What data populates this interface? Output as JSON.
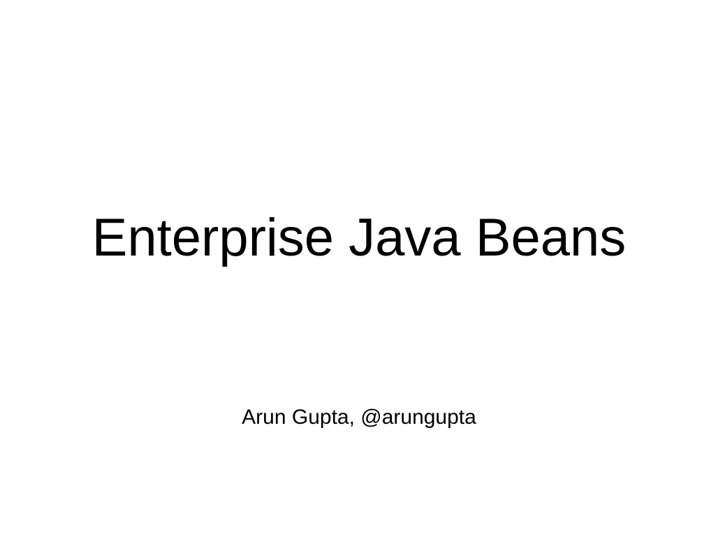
{
  "slide": {
    "title": "Enterprise Java Beans",
    "subtitle": "Arun Gupta, @arungupta"
  },
  "colors": {
    "background": "#ffffff",
    "text": "#000000"
  }
}
